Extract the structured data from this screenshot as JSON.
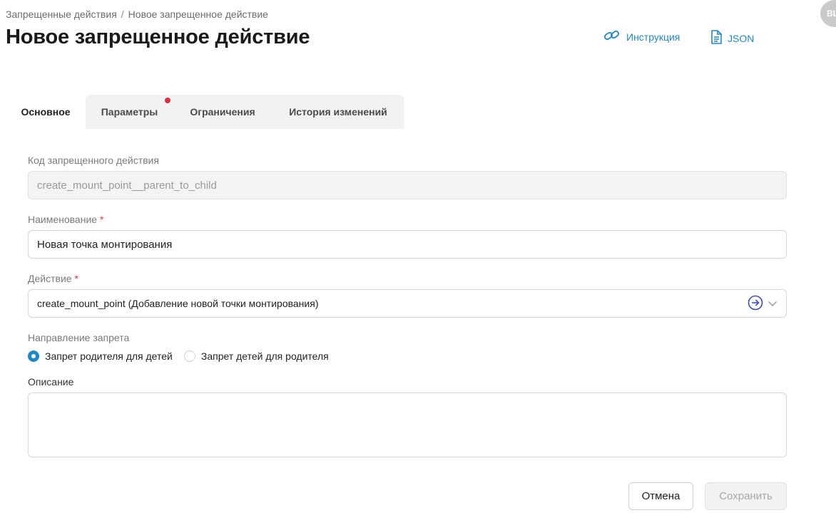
{
  "breadcrumb": {
    "parent": "Запрещенные действия",
    "separator": "/",
    "current": "Новое запрещенное действие"
  },
  "page_title": "Новое запрещенное действие",
  "header_links": {
    "instruction": "Инструкция",
    "json": "JSON"
  },
  "avatar": {
    "initials": "BL"
  },
  "tabs": [
    {
      "label": "Основное",
      "active": true
    },
    {
      "label": "Параметры",
      "has_indicator": true
    },
    {
      "label": "Ограничения"
    },
    {
      "label": "История изменений"
    }
  ],
  "form": {
    "code": {
      "label": "Код запрещенного действия",
      "value": "create_mount_point__parent_to_child"
    },
    "name": {
      "label": "Наименование",
      "required_mark": "*",
      "value": "Новая точка монтирования"
    },
    "action": {
      "label": "Действие",
      "required_mark": "*",
      "value": "create_mount_point (Добавление новой точки монтирования)"
    },
    "direction": {
      "label": "Направление запрета",
      "options": [
        {
          "label": "Запрет родителя для детей",
          "selected": true
        },
        {
          "label": "Запрет детей для родителя",
          "selected": false
        }
      ]
    },
    "description": {
      "label": "Описание",
      "value": ""
    }
  },
  "buttons": {
    "cancel": "Отмена",
    "save": "Сохранить"
  },
  "colors": {
    "accent": "#1e88c8",
    "required": "#e0303e",
    "indicator": "#e0303e"
  }
}
